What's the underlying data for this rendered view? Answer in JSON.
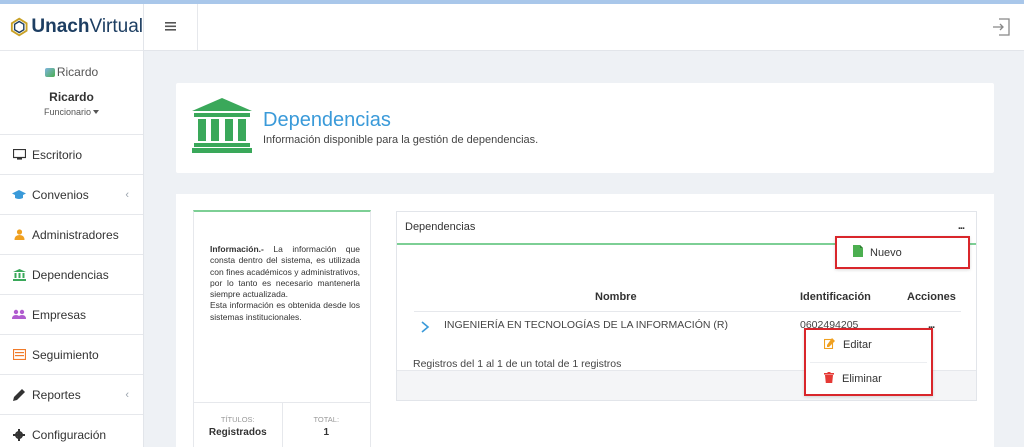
{
  "brand": {
    "part1": "Unach",
    "part2": "Virtual"
  },
  "profile": {
    "avatar_alt": "Ricardo",
    "name": "Ricardo",
    "role": "Funcionario"
  },
  "sidebar": {
    "items": [
      {
        "label": "Escritorio",
        "icon": "monitor-icon"
      },
      {
        "label": "Convenios",
        "icon": "graduation-cap-icon",
        "chevron": "‹"
      },
      {
        "label": "Administradores",
        "icon": "user-icon"
      },
      {
        "label": "Dependencias",
        "icon": "bank-icon"
      },
      {
        "label": "Empresas",
        "icon": "users-icon"
      },
      {
        "label": "Seguimiento",
        "icon": "list-alt-icon"
      },
      {
        "label": "Reportes",
        "icon": "pencil-icon",
        "chevron": "‹"
      },
      {
        "label": "Configuración",
        "icon": "gear-icon"
      }
    ]
  },
  "header": {
    "menu_icon": "≡",
    "logout_icon": "sign-out-icon"
  },
  "page": {
    "title": "Dependencias",
    "subtitle": "Información disponible para la gestión de dependencias."
  },
  "info": {
    "heading": "Información.-",
    "text1": "La información que consta dentro del sistema, es utilizada con fines académicos y administrativos, por lo tanto es necesario mantenerla siempre actualizada.",
    "text2": "Esta información es obtenida desde los sistemas institucionales.",
    "stats": [
      {
        "label": "TÍTULOS:",
        "value": "Registrados"
      },
      {
        "label": "TOTAL:",
        "value": "1"
      }
    ]
  },
  "panel": {
    "title": "Dependencias",
    "more": "...",
    "columns": {
      "nombre": "Nombre",
      "identificacion": "Identificación",
      "acciones": "Acciones"
    },
    "rows": [
      {
        "nombre": "INGENIERÍA EN TECNOLOGÍAS DE LA INFORMACIÓN (R)",
        "identificacion": "0602494205",
        "acciones": "..."
      }
    ],
    "footer": "Registros del 1 al 1 de un total de 1 registros"
  },
  "menu_new": {
    "label": "Nuevo"
  },
  "menu_row": {
    "edit": "Editar",
    "delete": "Eliminar"
  },
  "colors": {
    "accent": "#3a9ad9",
    "green": "#4caf50",
    "highlight": "#d9262b"
  }
}
